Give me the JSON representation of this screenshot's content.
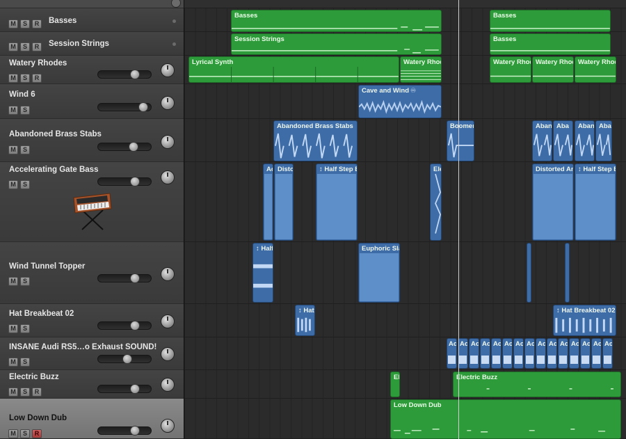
{
  "tracks": [
    {
      "id": "basses",
      "name": "Basses",
      "buttons": [
        "M",
        "S",
        "R"
      ],
      "has_fader": false
    },
    {
      "id": "session-strings",
      "name": "Session Strings",
      "buttons": [
        "M",
        "S",
        "R"
      ],
      "has_fader": false
    },
    {
      "id": "watery-rhodes",
      "name": "Watery Rhodes",
      "buttons": [
        "M",
        "S",
        "R"
      ],
      "has_fader": true
    },
    {
      "id": "wind-6",
      "name": "Wind 6",
      "buttons": [
        "M",
        "S"
      ],
      "has_fader": true
    },
    {
      "id": "abandoned-brass-stabs",
      "name": "Abandoned Brass Stabs",
      "buttons": [
        "M",
        "S"
      ],
      "has_fader": true
    },
    {
      "id": "accelerating-gate-bass",
      "name": "Accelerating Gate Bass",
      "buttons": [
        "M",
        "S"
      ],
      "has_fader": true
    },
    {
      "id": "wind-tunnel-topper",
      "name": "Wind Tunnel Topper",
      "buttons": [
        "M",
        "S"
      ],
      "has_fader": true
    },
    {
      "id": "hat-breakbeat-02",
      "name": "Hat Breakbeat 02",
      "buttons": [
        "M",
        "S"
      ],
      "has_fader": true
    },
    {
      "id": "insane-audi",
      "name": "INSANE Audi RS5…o Exhaust SOUND!",
      "buttons": [
        "M",
        "S"
      ],
      "has_fader": true
    },
    {
      "id": "electric-buzz",
      "name": "Electric Buzz",
      "buttons": [
        "M",
        "S",
        "R"
      ],
      "has_fader": true
    },
    {
      "id": "low-down-dub",
      "name": "Low Down Dub",
      "buttons": [
        "M",
        "S",
        "R"
      ],
      "has_fader": true,
      "selected": true,
      "record_armed": true
    }
  ],
  "regions": {
    "basses": [
      "Basses",
      "Basses"
    ],
    "session_strings": [
      "Session Strings",
      "Basses"
    ],
    "watery_rhodes": [
      "Lyrical Synth",
      "Watery Rhod",
      "Watery Rhod",
      "Watery Rhod",
      "Watery Rhod"
    ],
    "wind_6": [
      "Cave and Wind"
    ],
    "brass": [
      "Abandoned Brass Stabs",
      "Boomer",
      "Aband",
      "Aba",
      "Aband",
      "Aba"
    ],
    "gate_bass": [
      "Ac",
      "Distor",
      "↕ Half Step B",
      "Ele",
      "Distorted An",
      "↕ Half Step B"
    ],
    "wind_tunnel": [
      "↕ Half",
      "Euphoric Sla"
    ],
    "hat": [
      "↕ Hat",
      "↕ Hat Breakbeat 02."
    ],
    "audi_label": "Ac",
    "electric_buzz": [
      "El",
      "Electric Buzz"
    ],
    "low_down_dub": [
      "Low Down Dub"
    ]
  },
  "icons": {
    "track_icon": "vintage-synth-icon",
    "loop_badge": "loop-icon"
  },
  "colors": {
    "software_instrument": "#2e9b3a",
    "audio": "#3d6ca7",
    "record": "#b84545"
  }
}
